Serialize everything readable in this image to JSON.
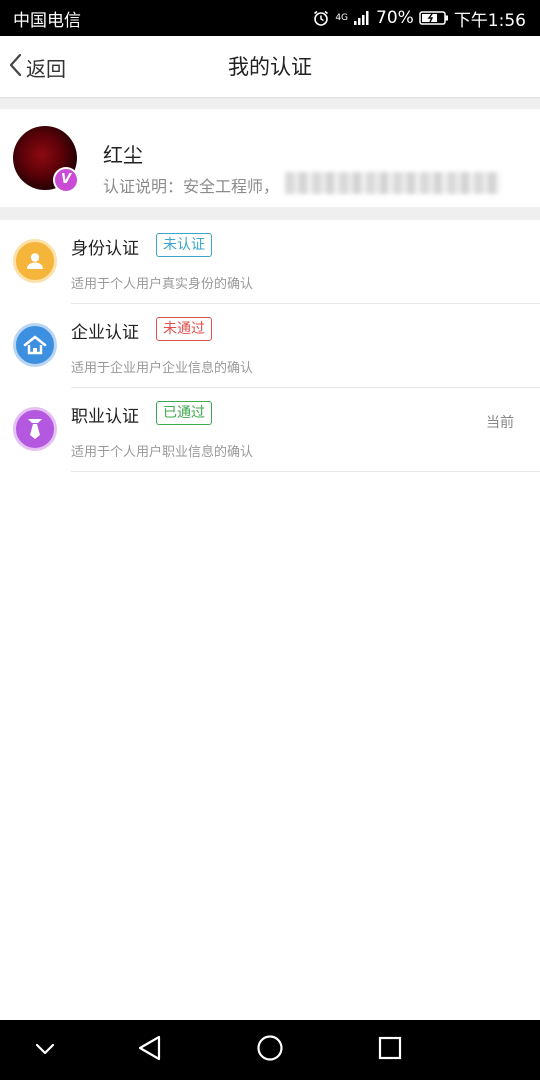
{
  "status_bar": {
    "carrier": "中国电信",
    "network": "4G",
    "battery": "70%",
    "time": "下午1:56"
  },
  "header": {
    "back_label": "返回",
    "title": "我的认证"
  },
  "profile": {
    "name": "红尘",
    "description": "认证说明：安全工程师，",
    "badge_letter": "V"
  },
  "certifications": [
    {
      "title": "身份认证",
      "status": "未认证",
      "status_color": "#3aa6c9",
      "description": "适用于个人用户真实身份的确认",
      "icon": "person-icon",
      "icon_color": "#f5b53a",
      "current": ""
    },
    {
      "title": "企业认证",
      "status": "未通过",
      "status_color": "#e0504f",
      "description": "适用于企业用户企业信息的确认",
      "icon": "house-icon",
      "icon_color": "#3d8fe0",
      "current": ""
    },
    {
      "title": "职业认证",
      "status": "已通过",
      "status_color": "#3daa4d",
      "description": "适用于个人用户职业信息的确认",
      "icon": "tie-icon",
      "icon_color": "#b458e0",
      "current": "当前"
    }
  ]
}
